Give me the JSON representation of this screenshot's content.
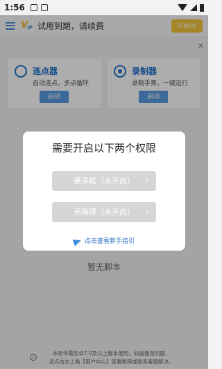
{
  "status_bar": {
    "time": "1:56"
  },
  "app_bar": {
    "title": "试用到期，请续费",
    "vip_button": "开通VIP",
    "logo_letters": "VIP"
  },
  "cards": [
    {
      "title": "连点器",
      "desc": "自动连点，多点循环",
      "button": "启动",
      "icon": "tap-icon"
    },
    {
      "title": "录制器",
      "desc": "录制手势，一键运行",
      "button": "启动",
      "icon": "record-icon"
    }
  ],
  "empty_text": "暂无脚本",
  "footer": {
    "line1": "本软件需安卓7.0及以上版本使用，如遇使用问题，",
    "line2": "请点击左上角【用户中心】查看教程或联系客服解决。"
  },
  "dialog": {
    "title": "需要开启以下两个权限",
    "btn_float": "悬浮框（未开启）",
    "btn_access": "无障碍（未开启）",
    "guide_link": "点击查看新手指引"
  },
  "colors": {
    "accent": "#1f72c9",
    "button_blue": "#5a9be0",
    "vip_yellow": "#f4c43a",
    "disabled_gray": "#d6d6d6"
  }
}
